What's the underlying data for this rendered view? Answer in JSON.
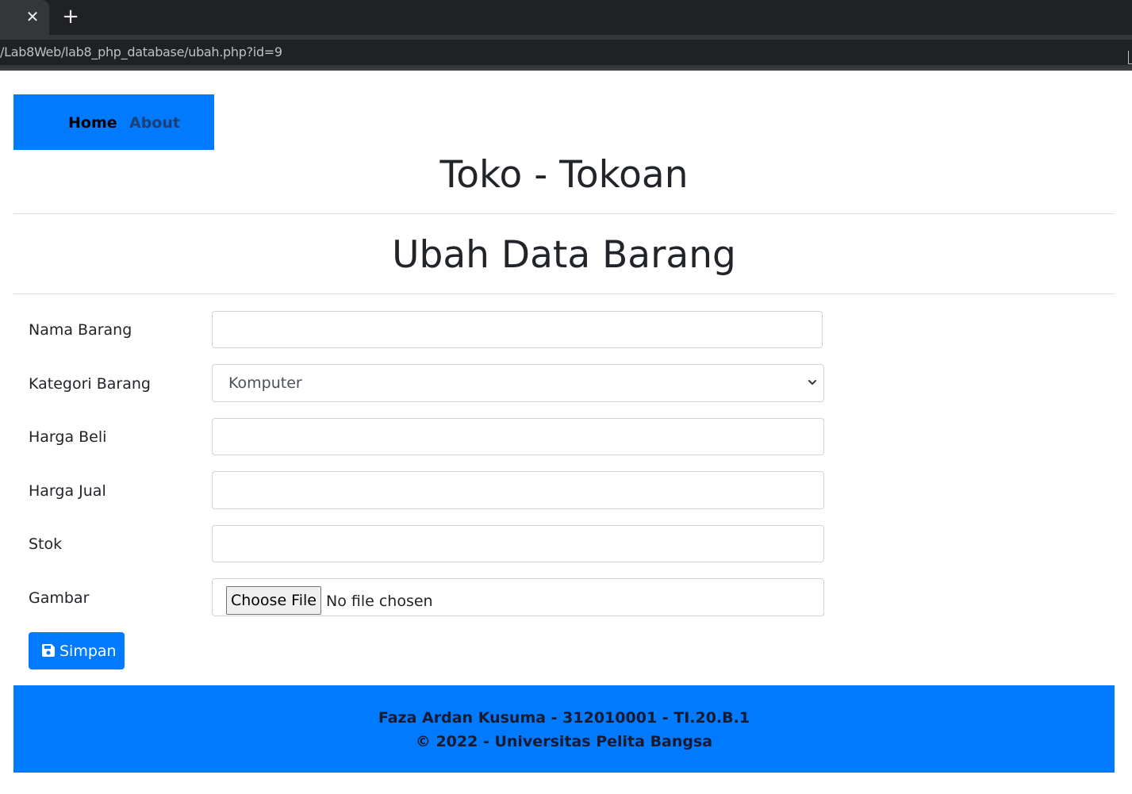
{
  "browser": {
    "tab_close_glyph": "✕",
    "new_tab_glyph": "+",
    "url": "/Lab8Web/lab8_php_database/ubah.php?id=9"
  },
  "nav": {
    "home_label": "Home",
    "about_label": "About"
  },
  "site_title": "Toko - Tokoan",
  "page_title": "Ubah Data Barang",
  "form": {
    "nama_label": "Nama Barang",
    "nama_value": "",
    "kategori_label": "Kategori Barang",
    "kategori_selected": "Komputer",
    "harga_beli_label": "Harga Beli",
    "harga_beli_value": "",
    "harga_jual_label": "Harga Jual",
    "harga_jual_value": "",
    "stok_label": "Stok",
    "stok_value": "",
    "gambar_label": "Gambar",
    "file_button_label": "Choose File",
    "file_status": "No file chosen",
    "submit_label": "Simpan"
  },
  "footer": {
    "line1": "Faza Ardan Kusuma - 312010001 - TI.20.B.1",
    "line2": "© 2022 - Universitas Pelita Bangsa"
  },
  "colors": {
    "primary": "#007bff",
    "text": "#212529"
  },
  "icons": {
    "save": "save-icon (floppy disk)",
    "select_arrow": "chevron-down-icon"
  }
}
